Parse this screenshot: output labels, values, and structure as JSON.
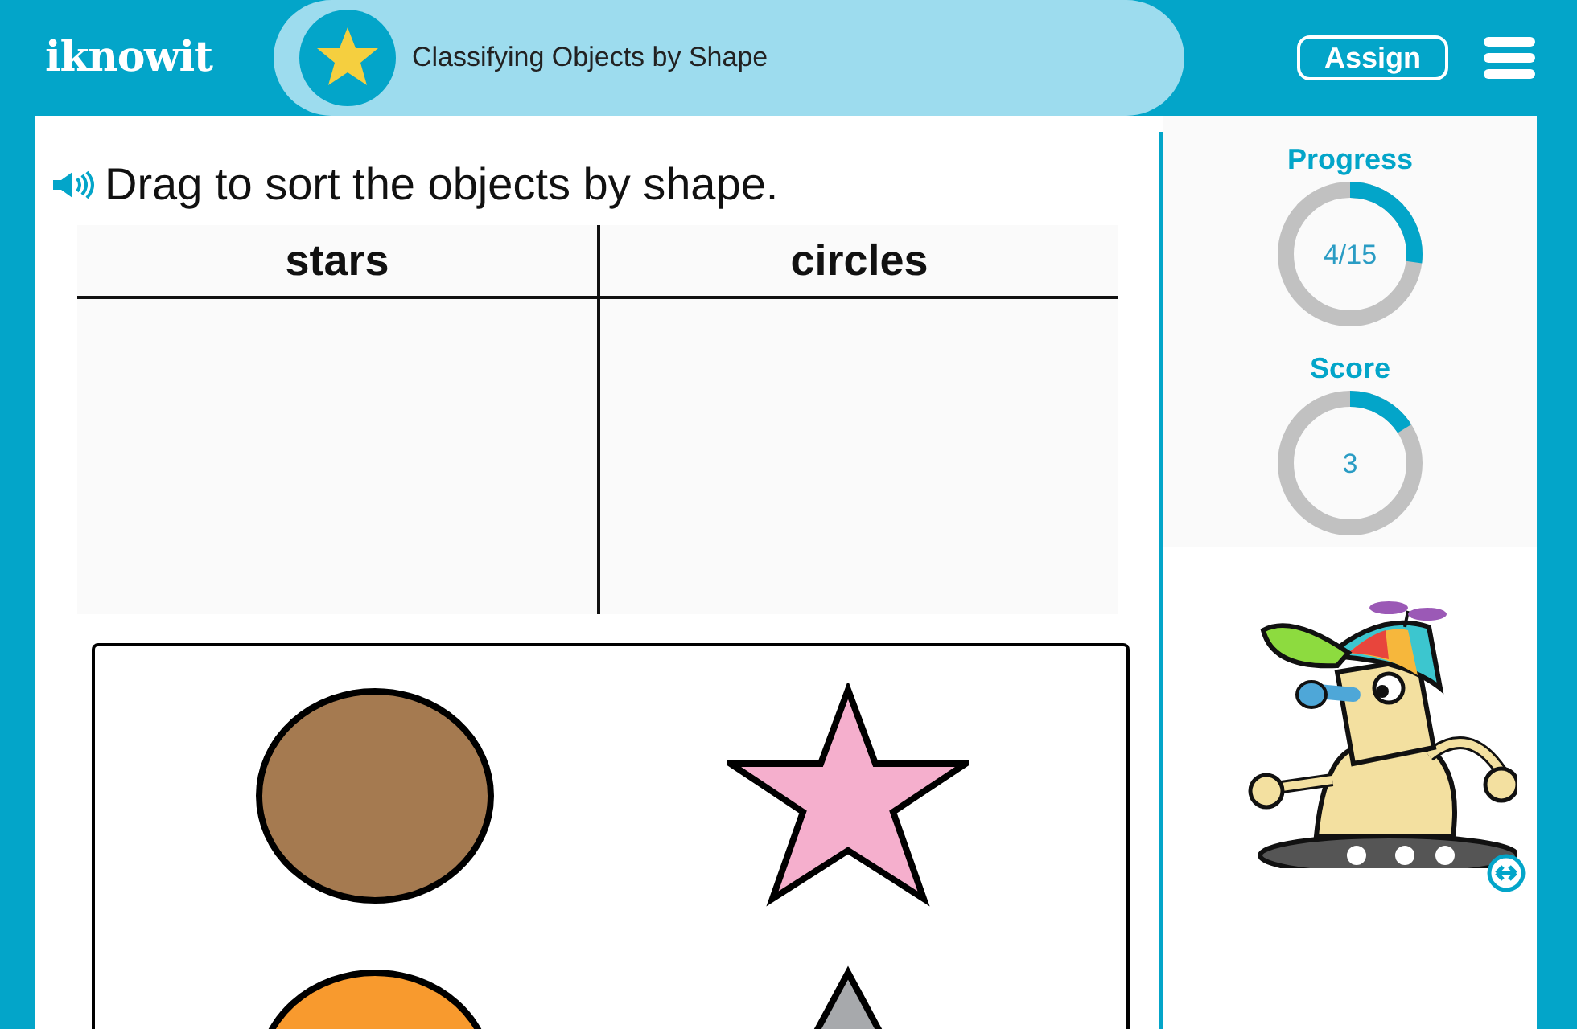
{
  "header": {
    "logo": "iknowit",
    "title": "Classifying Objects by Shape",
    "assign_button": "Assign"
  },
  "instruction": "Drag to sort the objects by shape.",
  "sort_table": {
    "columns": [
      "stars",
      "circles"
    ]
  },
  "objects": [
    {
      "kind": "circle",
      "color": "#a57a50"
    },
    {
      "kind": "star",
      "color": "#f5afcd"
    },
    {
      "kind": "circle",
      "color": "#f89a2e"
    },
    {
      "kind": "triangle",
      "color": "#a7a9ac"
    }
  ],
  "meters": [
    {
      "label": "Progress",
      "value": "4/15",
      "level": 0.27
    },
    {
      "label": "Score",
      "value": "3",
      "level": 0.16
    }
  ]
}
